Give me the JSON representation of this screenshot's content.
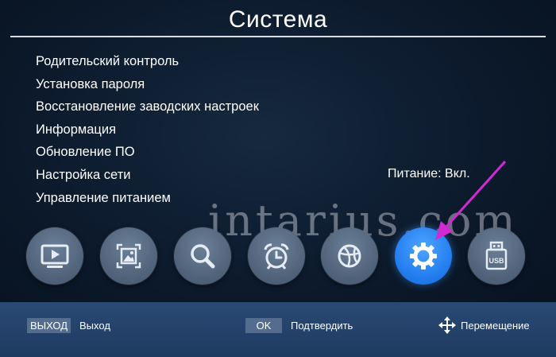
{
  "header": {
    "title": "Система"
  },
  "menu": {
    "items": [
      {
        "label": "Родительский контроль"
      },
      {
        "label": "Установка пароля"
      },
      {
        "label": "Восстановление заводских настроек"
      },
      {
        "label": "Информация"
      },
      {
        "label": "Обновление ПО"
      },
      {
        "label": "Настройка сети"
      },
      {
        "label": "Управление питанием"
      }
    ]
  },
  "status": {
    "power": "Питание: Вкл."
  },
  "watermark": {
    "text": "intarius.com"
  },
  "icon_bar": {
    "items": [
      {
        "icon": "tv-icon"
      },
      {
        "icon": "picture-icon"
      },
      {
        "icon": "search-icon"
      },
      {
        "icon": "alarm-clock-icon"
      },
      {
        "icon": "globe-icon"
      },
      {
        "icon": "gear-icon",
        "selected": true
      },
      {
        "icon": "usb-icon",
        "text": "USB"
      }
    ]
  },
  "footer": {
    "exit_key": "ВЫХОД",
    "exit_label": "Выход",
    "ok_key": "OK",
    "ok_label": "Подтвердить",
    "move_label": "Перемещение"
  },
  "colors": {
    "background": "#0c1a2c",
    "footer": "#1e3a60",
    "icon_idle": "#52657c",
    "icon_active": "#2580f0",
    "arrow": "#d22ad2"
  }
}
